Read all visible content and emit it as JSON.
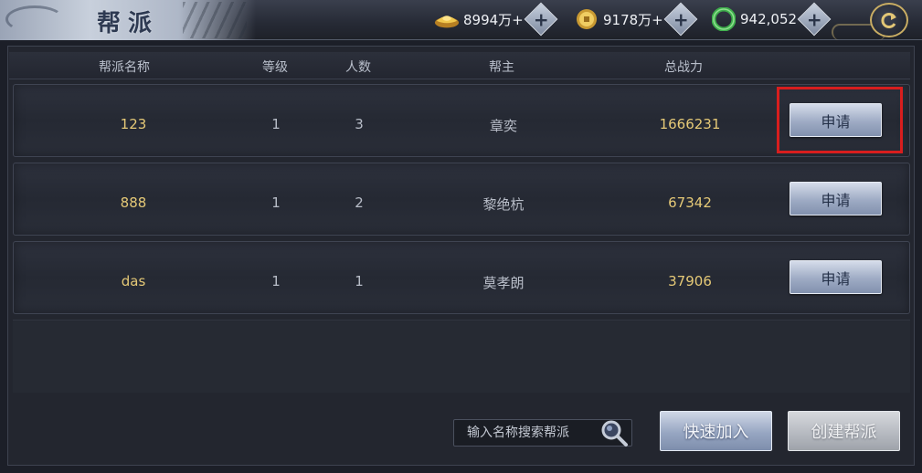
{
  "header": {
    "title": "帮派",
    "currencies": [
      {
        "name": "ingot",
        "icon": "gold-ingot-icon",
        "value": "8994万+"
      },
      {
        "name": "coin",
        "icon": "gold-coin-icon",
        "value": "9178万+"
      },
      {
        "name": "jade",
        "icon": "jade-ring-icon",
        "value": "942,052"
      }
    ],
    "plus_label": "+"
  },
  "table": {
    "columns": [
      "帮派名称",
      "等级",
      "人数",
      "帮主",
      "总战力"
    ],
    "rows": [
      {
        "name": "123",
        "level": "1",
        "members": "3",
        "leader": "章奕",
        "power": "1666231",
        "action": "申请"
      },
      {
        "name": "888",
        "level": "1",
        "members": "2",
        "leader": "黎绝杭",
        "power": "67342",
        "action": "申请"
      },
      {
        "name": "das",
        "level": "1",
        "members": "1",
        "leader": "莫孝朗",
        "power": "37906",
        "action": "申请"
      }
    ]
  },
  "footer": {
    "search_placeholder": "输入名称搜索帮派",
    "quick_join_label": "快速加入",
    "create_label": "创建帮派"
  },
  "colors": {
    "highlight": "#d81e1e",
    "gold_text": "#e5c977",
    "button_blue": "#97a6c2"
  }
}
